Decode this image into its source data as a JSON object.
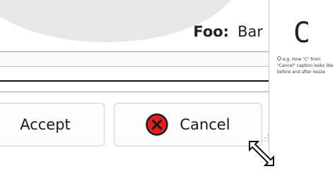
{
  "header": {
    "key": "Foo:",
    "value": "Bar"
  },
  "buttons": {
    "accept_label": "Accept",
    "cancel_label": "Cancel"
  },
  "side": {
    "glyph": "C",
    "note": "e.g. How \"C\" from \"Cancel\" caption looks like before and after resize"
  },
  "icons": {
    "cancel": "cancel-x-icon",
    "resize_cursor": "diagonal-resize-icon",
    "note_bullet": "info-icon"
  },
  "colors": {
    "cancel_red": "#e02020",
    "cancel_ring": "#1a1a1a"
  }
}
